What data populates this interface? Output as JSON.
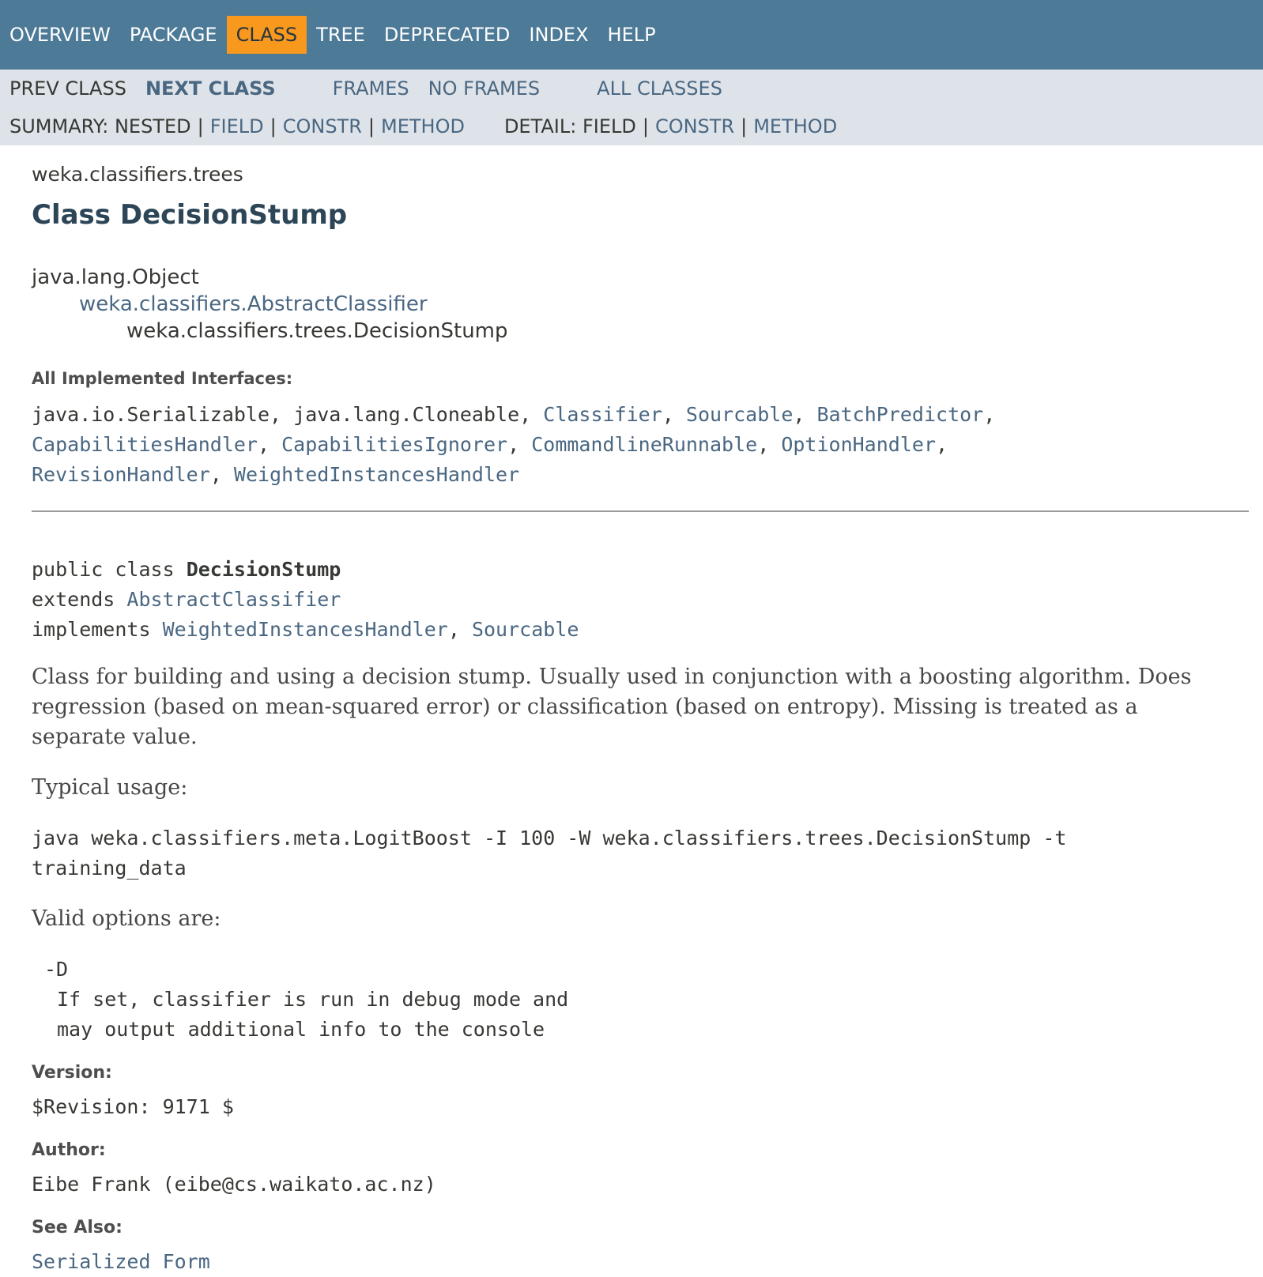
{
  "topnav": {
    "items": [
      {
        "label": "OVERVIEW"
      },
      {
        "label": "PACKAGE"
      },
      {
        "label": "CLASS",
        "active": true
      },
      {
        "label": "TREE"
      },
      {
        "label": "DEPRECATED"
      },
      {
        "label": "INDEX"
      },
      {
        "label": "HELP"
      }
    ],
    "active_color": "#f8981d",
    "bar_color": "#4d7a97"
  },
  "subnav": {
    "prev_class": "PREV CLASS",
    "next_class": "NEXT CLASS",
    "frames": "FRAMES",
    "no_frames": "NO FRAMES",
    "all_classes": "ALL CLASSES",
    "summary_label": "SUMMARY: NESTED",
    "summary_field": "FIELD",
    "summary_constr": "CONSTR",
    "summary_method": "METHOD",
    "detail_label": "DETAIL: FIELD",
    "detail_constr": "CONSTR",
    "detail_method": "METHOD",
    "separator": "|"
  },
  "header": {
    "package": "weka.classifiers.trees",
    "title": "Class DecisionStump"
  },
  "inheritance": {
    "root": "java.lang.Object",
    "parent": "weka.classifiers.AbstractClassifier",
    "self": "weka.classifiers.trees.DecisionStump"
  },
  "interfaces": {
    "label": "All Implemented Interfaces:",
    "plain1": "java.io.Serializable",
    "plain2": "java.lang.Cloneable",
    "links": [
      "Classifier",
      "Sourcable",
      "BatchPredictor",
      "CapabilitiesHandler",
      "CapabilitiesIgnorer",
      "CommandlineRunnable",
      "OptionHandler",
      "RevisionHandler",
      "WeightedInstancesHandler"
    ],
    "comma": ","
  },
  "declaration": {
    "prefix": "public class",
    "name": "DecisionStump",
    "extends_kw": "extends",
    "extends": "AbstractClassifier",
    "implements_kw": "implements",
    "implements1": "WeightedInstancesHandler",
    "implements2": "Sourcable"
  },
  "description": {
    "text": "Class for building and using a decision stump. Usually used in conjunction with a boosting algorithm. Does regression (based on mean-squared error) or classification (based on entropy). Missing is treated as a separate value.",
    "usage_label": "Typical usage:",
    "usage_line1": "java weka.classifiers.meta.LogitBoost -I 100 -W weka.classifiers.trees.DecisionStump -t",
    "usage_line2": "training_data",
    "valid_label": "Valid options are:",
    "option_flag": "-D",
    "option_desc1": "If set, classifier is run in debug mode and",
    "option_desc2": "may output additional info to the console"
  },
  "meta": {
    "version_label": "Version:",
    "version": "$Revision: 9171 $",
    "author_label": "Author:",
    "author": "Eibe Frank (eibe@cs.waikato.ac.nz)",
    "see_also_label": "See Also:",
    "see_also_link": "Serialized Form"
  }
}
